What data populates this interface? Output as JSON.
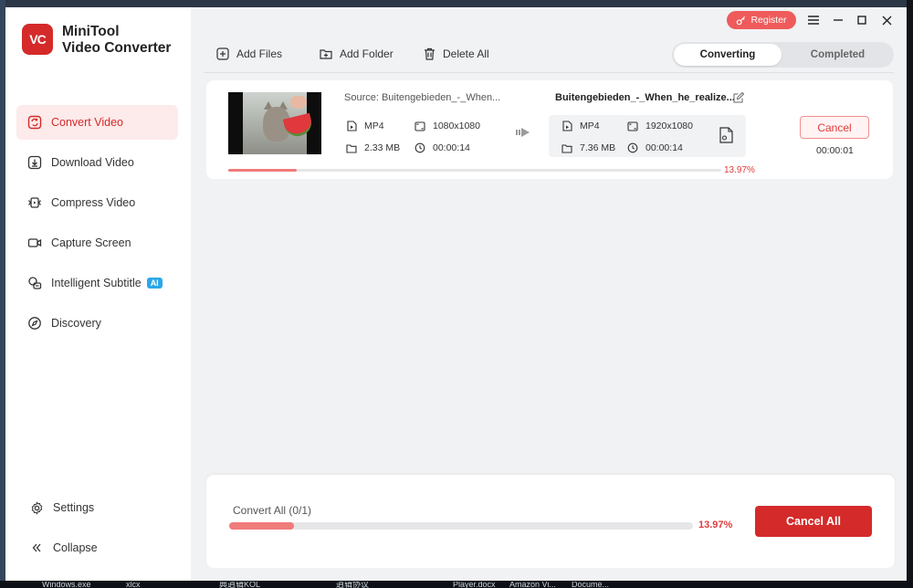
{
  "app": {
    "brand_line1": "MiniTool",
    "brand_line2": "Video Converter",
    "logo_text": "VC",
    "accent_color": "#d42a2a"
  },
  "titlebar": {
    "register_label": "Register",
    "menu_icon": "hamburger-icon",
    "minimize_icon": "minimize-icon",
    "maximize_icon": "maximize-icon",
    "close_icon": "close-icon"
  },
  "sidebar": {
    "items": [
      {
        "label": "Convert Video",
        "icon": "convert-icon",
        "active": true
      },
      {
        "label": "Download Video",
        "icon": "download-icon",
        "active": false
      },
      {
        "label": "Compress Video",
        "icon": "compress-icon",
        "active": false
      },
      {
        "label": "Capture Screen",
        "icon": "camera-icon",
        "active": false
      },
      {
        "label": "Intelligent Subtitle",
        "icon": "subtitle-icon",
        "active": false,
        "badge": "AI"
      },
      {
        "label": "Discovery",
        "icon": "compass-icon",
        "active": false
      }
    ],
    "settings_label": "Settings",
    "collapse_label": "Collapse"
  },
  "toolbar": {
    "add_files": "Add Files",
    "add_folder": "Add Folder",
    "delete_all": "Delete All"
  },
  "tabs": {
    "converting": "Converting",
    "completed": "Completed",
    "active": "converting"
  },
  "task": {
    "source_label": "Source:   Buitengebieden_-_When...",
    "source": {
      "format": "MP4",
      "resolution": "1080x1080",
      "size": "2.33 MB",
      "duration": "00:00:14"
    },
    "output_name": "Buitengebieden_-_When_he_realize...",
    "output": {
      "format": "MP4",
      "resolution": "1920x1080",
      "size": "7.36 MB",
      "duration": "00:00:14"
    },
    "progress_percent": 13.97,
    "progress_label": "13.97%",
    "cancel_label": "Cancel",
    "elapsed": "00:00:01"
  },
  "bottom": {
    "convert_all_label": "Convert All (0/1)",
    "progress_percent": 13.97,
    "progress_label": "13.97%",
    "cancel_all_label": "Cancel All"
  },
  "taskbar": {
    "labels": [
      "Windows.exe",
      "xlcx",
      "典逍辑KOL",
      "逍辑协议",
      "Player.docx",
      "Amazon Vi...",
      "Docume..."
    ]
  }
}
